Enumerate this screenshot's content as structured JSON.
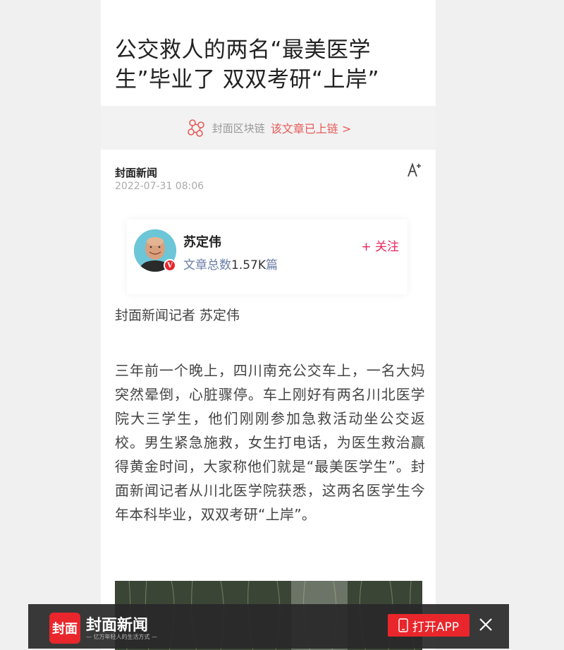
{
  "article": {
    "headline": "公交救人的两名“最美医学生”毕业了 双双考研“上岸”",
    "source": "封面新闻",
    "date": "2022-07-31 08:06",
    "byline": "封面新闻记者 苏定伟",
    "body": "三年前一个晚上，四川南充公交车上，一名大妈突然晕倒，心脏骤停。车上刚好有两名川北医学院大三学生，他们刚刚参加急救活动坐公交返校。男生紧急施救，女生打电话，为医生救治赢得黄金时间，大家称他们就是“最美医学生”。封面新闻记者从川北医学院获悉，这两名医学生今年本科毕业，双双考研“上岸”。"
  },
  "blockchain": {
    "label": "封面区块链",
    "link_text": "该文章已上链 >",
    "icon": "blockchain-icon"
  },
  "author": {
    "name": "苏定伟",
    "stats_label": "文章总数",
    "stats_count": "1.57K",
    "stats_unit": "篇",
    "follow_label": "+ 关注",
    "badge": "V"
  },
  "banner": {
    "logo_text": "封面",
    "app_name": "封面新闻",
    "slogan": "— 亿万年轻人的生活方式 —",
    "open_app_label": "打开APP"
  },
  "colors": {
    "accent": "#e8262b",
    "link": "#e85a5a",
    "follow": "#e8265a"
  }
}
